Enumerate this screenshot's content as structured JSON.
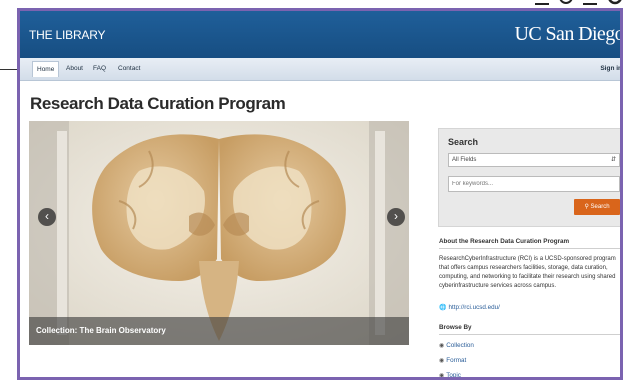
{
  "header": {
    "library_title": "THE LIBRARY",
    "logo_text": "UC San Diego"
  },
  "nav": {
    "items": [
      "Home",
      "About",
      "FAQ",
      "Contact"
    ],
    "active": "Home",
    "sign_in": "Sign in"
  },
  "page": {
    "title": "Research Data Curation Program"
  },
  "hero": {
    "caption": "Collection: The Brain Observatory"
  },
  "search": {
    "title": "Search",
    "field_selected": "All Fields",
    "keyword_placeholder": "For keywords...",
    "button_label": "Search"
  },
  "about": {
    "title": "About the Research Data Curation Program",
    "text": "ResearchCyberInfrastructure (RCI) is a UCSD-sponsored program that offers campus researchers facilities, storage, data curation, computing, and networking to facilitate their research using shared cyberinfrastructure services across campus.",
    "link": "http://rci.ucsd.edu/"
  },
  "browse": {
    "title": "Browse By",
    "items": [
      "Collection",
      "Format",
      "Topic"
    ]
  },
  "colors": {
    "header": "#1f5f9a",
    "accent": "#d9651b",
    "frame": "#7b63b0",
    "link": "#2a5d98"
  }
}
